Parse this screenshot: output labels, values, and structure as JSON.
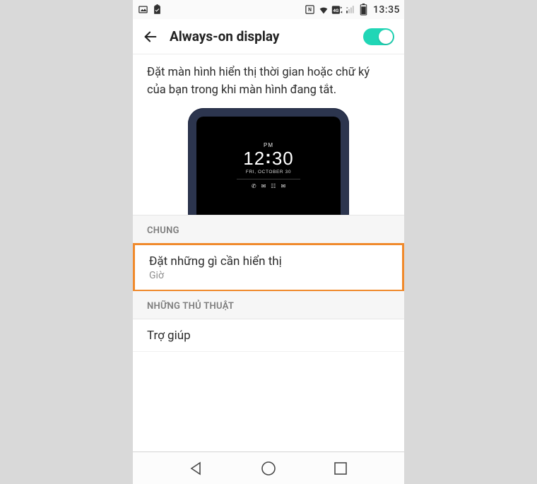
{
  "statusbar": {
    "clock": "13:35"
  },
  "appbar": {
    "title": "Always-on display"
  },
  "description": "Đặt màn hình hiển thị thời gian hoặc chữ ký của bạn trong khi màn hình đang tắt.",
  "preview": {
    "ampm": "PM",
    "hh": "12",
    "mm": "30",
    "date": "FRI, OCTOBER 30"
  },
  "sections": {
    "general_label": "CHUNG",
    "set_show": {
      "title": "Đặt những gì cần hiển thị",
      "subtitle": "Giờ"
    },
    "tips_label": "NHỮNG THỦ THUẬT",
    "help": {
      "title": "Trợ giúp"
    }
  }
}
